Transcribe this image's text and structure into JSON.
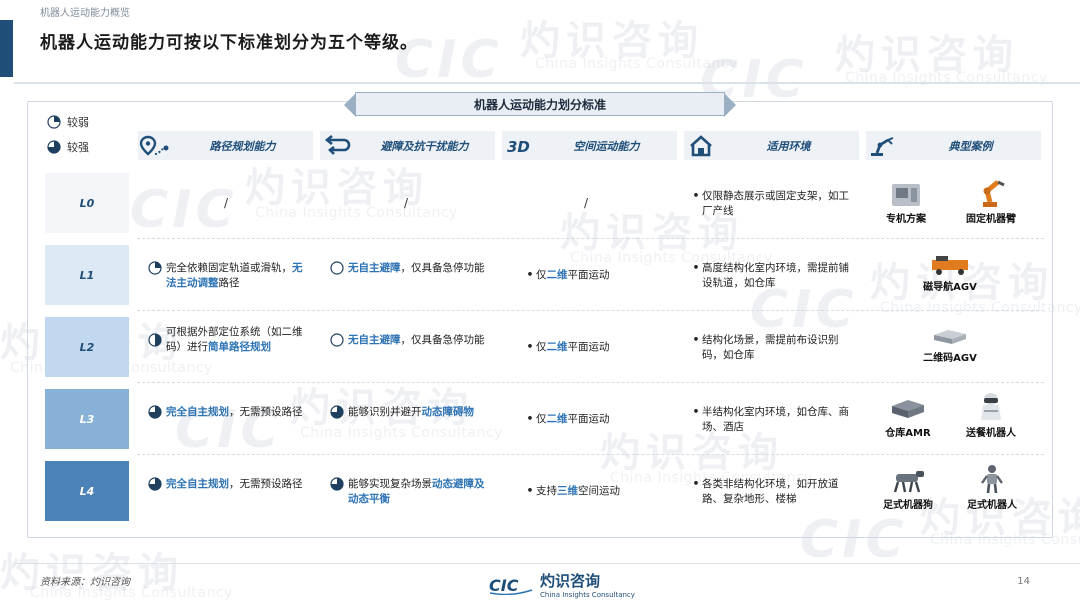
{
  "header": {
    "section": "机器人运动能力概览",
    "headline": "机器人运动能力可按以下标准划分为五个等级。"
  },
  "panel_title": "机器人运动能力划分标准",
  "legend": [
    {
      "label": "较弱",
      "level": 0.25
    },
    {
      "label": "较强",
      "level": 0.75
    }
  ],
  "columns": [
    {
      "label": "路径规划能力",
      "icon": "route-pin-icon"
    },
    {
      "label": "避障及抗干扰能力",
      "icon": "avoid-arrows-icon"
    },
    {
      "label": "空间运动能力",
      "icon": "3d-icon"
    },
    {
      "label": "适用环境",
      "icon": "home-icon"
    },
    {
      "label": "典型案例",
      "icon": "robot-arm-icon"
    }
  ],
  "rows": [
    {
      "level": "L0",
      "path": "/",
      "avoid": "/",
      "space": "/",
      "env": "仅限静态展示或固定支架，如工厂产线",
      "cases": [
        "专机方案",
        "固定机器臂"
      ]
    },
    {
      "level": "L1",
      "path": {
        "level": 0.25,
        "parts": [
          {
            "t": "完全依赖固定轨道或滑轨，"
          },
          {
            "t": "无法主动调整",
            "hl": true
          },
          {
            "t": "路径"
          }
        ]
      },
      "avoid": {
        "level": 0,
        "parts": [
          {
            "t": "无自主避障",
            "hl": true
          },
          {
            "t": "，仅具备急停功能"
          }
        ]
      },
      "space": {
        "parts": [
          {
            "t": "仅"
          },
          {
            "t": "二维",
            "hl": true
          },
          {
            "t": "平面运动"
          }
        ]
      },
      "env": "高度结构化室内环境，需提前铺设轨道，如仓库",
      "cases": [
        "磁导航AGV"
      ]
    },
    {
      "level": "L2",
      "path": {
        "level": 0.5,
        "parts": [
          {
            "t": "可根据外部定位系统（如二维码）进行"
          },
          {
            "t": "简单路径规划",
            "hl": true
          }
        ]
      },
      "avoid": {
        "level": 0,
        "parts": [
          {
            "t": "无自主避障",
            "hl": true
          },
          {
            "t": "，仅具备急停功能"
          }
        ]
      },
      "space": {
        "parts": [
          {
            "t": "仅"
          },
          {
            "t": "二维",
            "hl": true
          },
          {
            "t": "平面运动"
          }
        ]
      },
      "env": "结构化场景，需提前布设识别码，如仓库",
      "cases": [
        "二维码AGV"
      ]
    },
    {
      "level": "L3",
      "path": {
        "level": 0.75,
        "parts": [
          {
            "t": "完全自主规划",
            "hl": true
          },
          {
            "t": "，无需预设路径"
          }
        ]
      },
      "avoid": {
        "level": 0.75,
        "parts": [
          {
            "t": "能够识别并避开"
          },
          {
            "t": "动态障碍物",
            "hl": true
          }
        ]
      },
      "space": {
        "parts": [
          {
            "t": "仅"
          },
          {
            "t": "二维",
            "hl": true
          },
          {
            "t": "平面运动"
          }
        ]
      },
      "env": "半结构化室内环境，如仓库、商场、酒店",
      "cases": [
        "仓库AMR",
        "送餐机器人"
      ]
    },
    {
      "level": "L4",
      "path": {
        "level": 0.75,
        "parts": [
          {
            "t": "完全自主规划",
            "hl": true
          },
          {
            "t": "，无需预设路径"
          }
        ]
      },
      "avoid": {
        "level": 0.75,
        "parts": [
          {
            "t": "能够实现复杂场景"
          },
          {
            "t": "动态避障及动态平衡",
            "hl": true
          }
        ]
      },
      "space": {
        "parts": [
          {
            "t": "支持"
          },
          {
            "t": "三维",
            "hl": true
          },
          {
            "t": "空间运动"
          }
        ]
      },
      "env": "各类非结构化环境，如开放道路、复杂地形、楼梯",
      "cases": [
        "足式机器狗",
        "足式机器人"
      ]
    }
  ],
  "level_colors": [
    "#f3f5f8",
    "#dde9f5",
    "#c2d8ee",
    "#87b1d6",
    "#4b82b8"
  ],
  "footer": {
    "source": "资料来源：灼识咨询",
    "logo_cn": "灼识咨询",
    "logo_en": "China Insights Consultancy",
    "page": "14"
  },
  "watermark": {
    "cn": "灼识咨询",
    "en": "China Insights Consultancy",
    "logo": "CIC"
  }
}
